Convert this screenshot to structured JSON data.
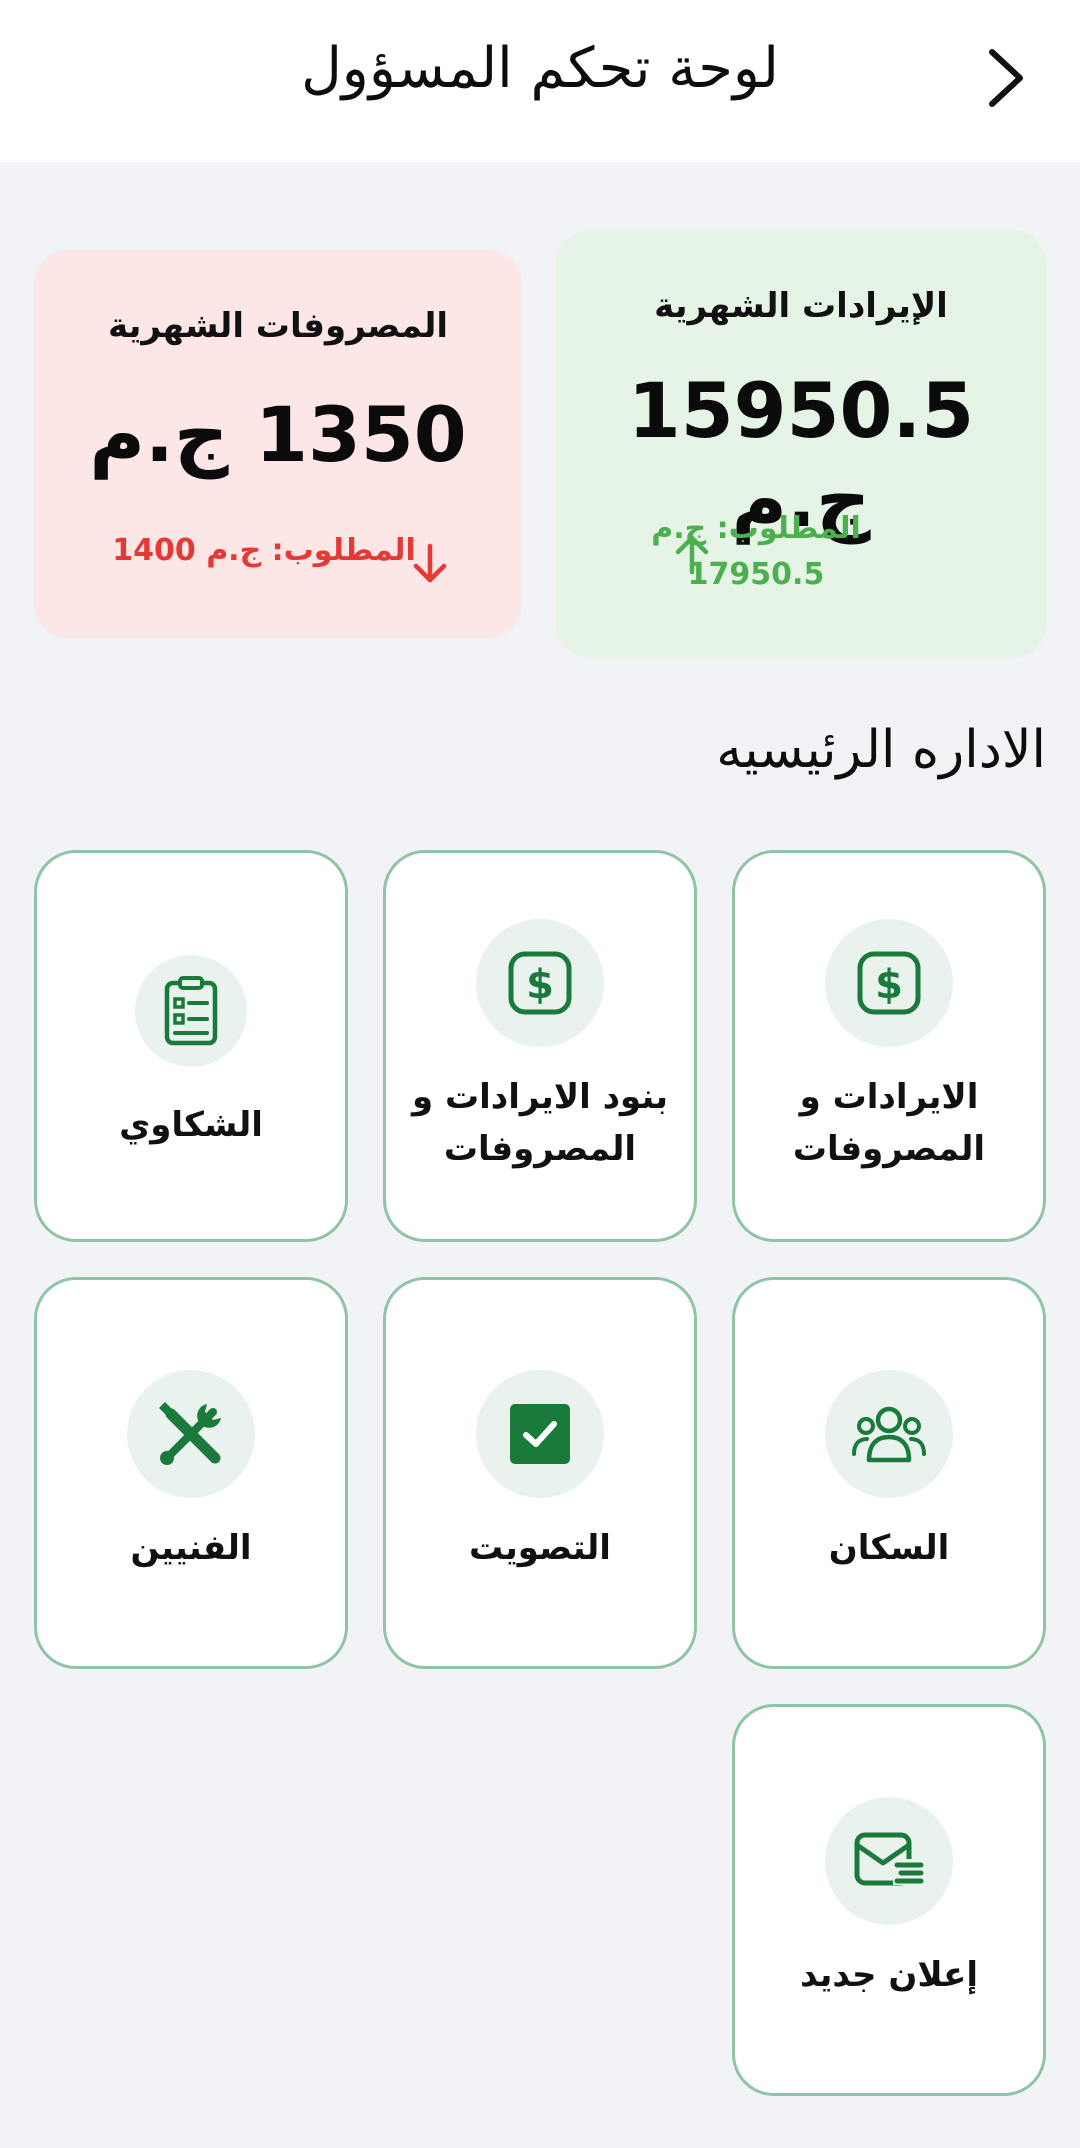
{
  "header": {
    "title": "لوحة تحكم المسؤول"
  },
  "summary": {
    "revenue": {
      "label": "الإيرادات الشهرية",
      "amount": "15950.5 ج.م",
      "required": "المطلوب: ج.م 17950.5",
      "trend": "up",
      "color": "#4caf50",
      "background": "#e5f4e5"
    },
    "expenses": {
      "label": "المصروفات الشهرية",
      "amount": "1350 ج.م",
      "required": "المطلوب: ج.م 1400",
      "trend": "down",
      "color": "#e53935",
      "background": "#fde6e6"
    }
  },
  "section": {
    "title": "الاداره الرئيسيه"
  },
  "tiles": [
    {
      "label": "الايرادات و المصروفات",
      "icon": "dollar-icon"
    },
    {
      "label": "بنود الايرادات و المصروفات",
      "icon": "dollar-icon"
    },
    {
      "label": "الشكاوي",
      "icon": "clipboard-icon"
    },
    {
      "label": "السكان",
      "icon": "residents-icon"
    },
    {
      "label": "التصويت",
      "icon": "vote-check-icon"
    },
    {
      "label": "الفنيين",
      "icon": "tools-icon"
    },
    {
      "label": "إعلان جديد",
      "icon": "announcement-icon"
    }
  ],
  "colors": {
    "accent_green": "#1a7a3c",
    "tile_border": "#8fc4a4",
    "page_background": "#f1f3f6"
  }
}
